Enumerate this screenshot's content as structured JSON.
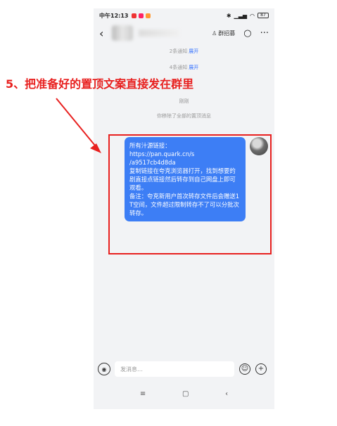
{
  "status_bar": {
    "time": "中午12:13",
    "battery": "87"
  },
  "header": {
    "group_recruit_label": "群招募"
  },
  "notices": [
    {
      "text": "2条通知",
      "action": "展开"
    },
    {
      "text": "4条通知",
      "action": "展开"
    },
    {
      "text": "刚刚",
      "action": ""
    },
    {
      "text": "你移除了全部的置顶消息",
      "action": ""
    }
  ],
  "message": {
    "text": "所有汁源链接：\nhttps://pan.quark.cn/s\n/a9517cb4d8da\n复制链接在夸克浏览器打开，找到想要的剧直接点链接然后转存到自己网盘上即可观看。\n备注：夸克新用户首次转存文件后会赠送1T空间，文件超过限制转存不了可以分批次转存。"
  },
  "input": {
    "placeholder": "发消息…"
  },
  "annotation": {
    "text": "5、把准备好的置顶文案直接发在群里"
  },
  "colors": {
    "bubble": "#3d7ef5",
    "annotation": "#e8201f",
    "link": "#3370ff"
  }
}
